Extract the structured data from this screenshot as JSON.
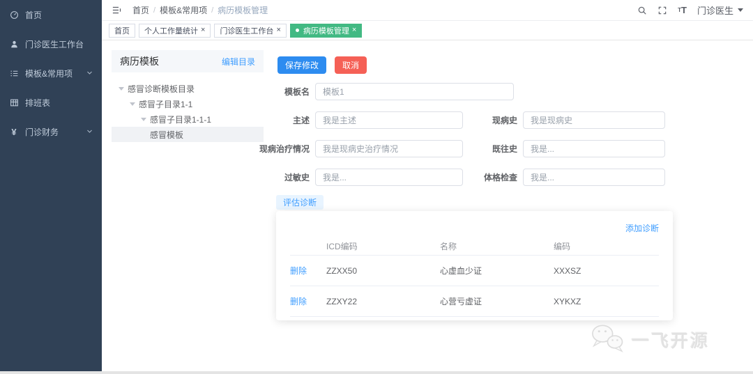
{
  "sidebar": {
    "items": [
      {
        "label": "首页",
        "icon": "dashboard-icon",
        "expandable": false
      },
      {
        "label": "门诊医生工作台",
        "icon": "user-icon",
        "expandable": false
      },
      {
        "label": "模板&常用项",
        "icon": "list-icon",
        "expandable": true
      },
      {
        "label": "排班表",
        "icon": "table-icon",
        "expandable": false
      },
      {
        "label": "门诊财务",
        "icon": "yen-icon",
        "yen_glyph": "¥",
        "expandable": true
      }
    ]
  },
  "topbar": {
    "breadcrumb": {
      "items": [
        "首页",
        "模板&常用项",
        "病历模板管理"
      ],
      "separator": "/"
    },
    "user_name": "门诊医生"
  },
  "tabs": [
    {
      "label": "首页",
      "active": false
    },
    {
      "label": "个人工作量统计",
      "close": "×",
      "active": false
    },
    {
      "label": "门诊医生工作台",
      "close": "×",
      "active": false
    },
    {
      "label": "病历模板管理",
      "close": "×",
      "active": true
    }
  ],
  "template_panel": {
    "title": "病历模板",
    "edit_link": "编辑目录",
    "tree": [
      {
        "label": "感冒诊断模板目录",
        "level": 0,
        "selected": false
      },
      {
        "label": "感冒子目录1-1",
        "level": 1,
        "selected": false
      },
      {
        "label": "感冒子目录1-1-1",
        "level": 2,
        "selected": false
      },
      {
        "label": "感冒模板",
        "level": 3,
        "selected": true
      }
    ]
  },
  "editor": {
    "save_button": "保存修改",
    "cancel_button": "取消",
    "fields": {
      "template_name": {
        "label": "模板名",
        "value": "模板1"
      },
      "chief_complaint": {
        "label": "主述",
        "value": "我是主述"
      },
      "present_illness": {
        "label": "现病史",
        "value": "我是现病史"
      },
      "present_treatment": {
        "label": "现病治疗情况",
        "value": "我是现病史治疗情况"
      },
      "past_history": {
        "label": "既往史",
        "value": "我是..."
      },
      "allergy_history": {
        "label": "过敏史",
        "value": "我是..."
      },
      "physical_exam": {
        "label": "体格检查",
        "value": "我是..."
      }
    },
    "diagnosis": {
      "tab_label": "评估诊断",
      "add_link": "添加诊断",
      "table": {
        "headers": {
          "action": "",
          "icd": "ICD编码",
          "name": "名称",
          "code": "编码"
        },
        "rows": [
          {
            "action": "删除",
            "icd": "ZZXX50",
            "name": "心虚血少证",
            "code": "XXXSZ"
          },
          {
            "action": "删除",
            "icd": "ZZXY22",
            "name": "心营亏虚证",
            "code": "XYKXZ"
          }
        ]
      }
    }
  },
  "watermark": {
    "text": "一飞开源"
  },
  "colors": {
    "sidebar_bg": "#304156",
    "sidebar_text": "#bfcbd9",
    "active_tab_green": "#42b983",
    "primary_blue": "#2d8cf0",
    "danger_red": "#f56056",
    "link_blue": "#409eff"
  }
}
